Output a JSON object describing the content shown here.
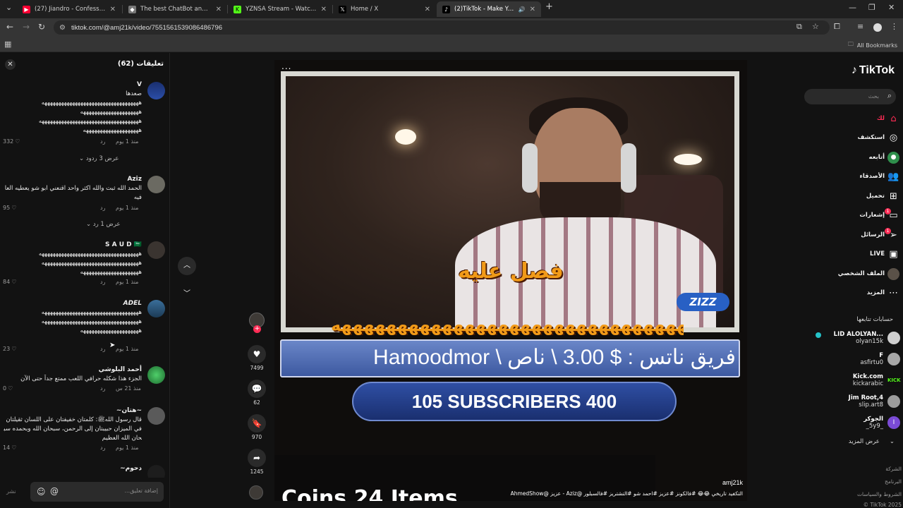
{
  "browser": {
    "tabs": [
      {
        "title": "(27) Jiandro - Confess your love",
        "fav": "youtube-icon",
        "color": "#ff0033"
      },
      {
        "title": "The best ChatBot and Widgets",
        "fav": "chatbot-icon",
        "color": "#777777"
      },
      {
        "title": "YZNSA Stream - Watch Live on",
        "fav": "kick-icon",
        "color": "#53fc18"
      },
      {
        "title": "Home / X",
        "fav": "x-icon",
        "color": "#000000"
      },
      {
        "title": "(2)TikTok - Make Your Day",
        "fav": "tiktok-icon",
        "color": "#000000"
      }
    ],
    "new_tab": "+",
    "url": "tiktok.com/@amj21k/video/7551561539086486796",
    "all_bookmarks": "All Bookmarks"
  },
  "comments": {
    "title": "تعليقات (62)",
    "input_placeholder": "إضافة تعليق...",
    "post_label": "نشر",
    "reply_label": "رد",
    "items": [
      {
        "name": "V",
        "text": "صعدها\nهههههههههههههههههههههههههههههههههههه\nهههههههههههههههههههههه\nههههههههههههههههههههههههههههههههههههه\nههههههههههههههههههههه",
        "time": "منذ 1 يوم",
        "likes": "332"
      },
      {
        "name": "Aziz",
        "text": "الحمد الله ثبت والله اكثر واحد اقنعني ابو شو يعطيه العافيه",
        "time": "منذ 1 يوم",
        "likes": "95"
      },
      {
        "name": "S A U D 🇸🇦",
        "text": "ههههههههههههههههههههههههههههههههههههه\nهههههههههههههههههههههههههههههههههههه\nهههههههههههههههههههههه",
        "time": "منذ 1 يوم",
        "likes": "84"
      },
      {
        "name": "ADEL",
        "text": "هههههههههههههههههههههههههههههههههههه\nهههههههههههههههههههههههههههههههههههه\nهههههههههههههههههههههه",
        "time": "منذ 1 يوم",
        "likes": "23"
      },
      {
        "name": "أحمد البلوشي",
        "text": "الجزء هذا شكله حرافي اللعب ممتع جداً حتى الآن",
        "time": "منذ 21 س",
        "likes": "0"
      },
      {
        "name": "~هتان~",
        "text": "قال رسول اللهﷺ: كلمتان خفيفتان على اللسان ثقيلتان في الميزان حبيبتان إلى الرحمن، سبحان الله وبحمده سبحان الله العظيم",
        "time": "منذ 1 يوم",
        "likes": "14"
      },
      {
        "name": "~دحوم",
        "text": "",
        "time": "",
        "likes": ""
      }
    ],
    "view_replies": [
      "عرض 3 ردود",
      "عرض 1 رد"
    ]
  },
  "video": {
    "menu": "...",
    "caption_1": "فصل عليه",
    "caption_2": "هههههههههههههههههههههههههههههههههههه",
    "banner": "Hamoodmor \\ فريق ناتس : $ 3.00 \\ ناص",
    "subscribers": "105 SUBSCRIBERS 400",
    "coins": "Coins 24 Items",
    "badge": "ZIZZ",
    "author": "amj21k",
    "hashtags": "التكفيد تاريخي 😂😂 #فالكونز #عزيز #احمد شو #التشتريز #فالسبلور @Aziz - عزيز @AhmedShow",
    "progress_pct": 2
  },
  "actions": {
    "likes": "7499",
    "comments": "62",
    "saves": "970",
    "shares": "1245"
  },
  "sidebar": {
    "logo": "TikTok",
    "search_placeholder": "بحث",
    "nav": [
      {
        "label": "لك",
        "icon": "home-icon"
      },
      {
        "label": "استكشف",
        "icon": "compass-icon"
      },
      {
        "label": "أتابعه",
        "icon": "following-icon"
      },
      {
        "label": "الأصدقاء",
        "icon": "friends-icon"
      },
      {
        "label": "تحميل",
        "icon": "upload-icon"
      },
      {
        "label": "إشعارات",
        "icon": "inbox-icon",
        "badge": "1"
      },
      {
        "label": "الرسائل",
        "icon": "messages-icon",
        "badge": "1"
      },
      {
        "label": "LIVE",
        "icon": "live-icon"
      },
      {
        "label": "الملف الشخصي",
        "icon": "profile-icon"
      },
      {
        "label": "المزيد",
        "icon": "more-icon"
      }
    ],
    "following_title": "حسابات تتابعها",
    "following": [
      {
        "name": "LID ALOLYAN...",
        "handle": "olyan15k",
        "live": true
      },
      {
        "name": "F",
        "handle": "asfirtu0"
      },
      {
        "name": "Kick.com",
        "handle": "kickarabic"
      },
      {
        "name": "Jim Root,4",
        "handle": "slip.art8"
      },
      {
        "name": "الجوكر",
        "handle": "_5y9_"
      }
    ],
    "see_more": "عرض المزيد",
    "footer": [
      "الشركة",
      "البرنامج",
      "الشروط والسياسات",
      "TikTok 2025 ©"
    ]
  }
}
